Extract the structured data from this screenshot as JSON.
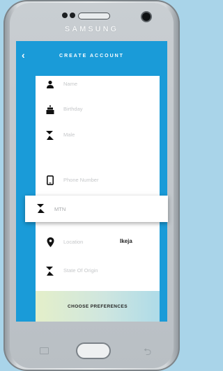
{
  "device": {
    "brand": "SAMSUNG"
  },
  "header": {
    "back_icon": "chevron-left-icon",
    "back_glyph": "‹",
    "title": "CREATE ACCOUNT"
  },
  "form": {
    "fields": [
      {
        "icon": "person-icon",
        "label": "Name",
        "value": ""
      },
      {
        "icon": "birthday-cake-icon",
        "label": "Birthday",
        "value": ""
      },
      {
        "icon": "gender-icon",
        "label": "Male",
        "value": ""
      },
      {
        "icon": "phone-icon",
        "label": "Phone Number",
        "value": ""
      },
      {
        "icon": "location-pin-icon",
        "label": "Location",
        "value": "Ikeja"
      },
      {
        "icon": "hourglass-icon",
        "label": "State Of Origin",
        "value": ""
      }
    ],
    "network_popup": {
      "icon": "hourglass-icon",
      "label": "MTN"
    },
    "cta_label": "CHOOSE PREFERENCES"
  },
  "colors": {
    "screen_bg": "#1a9bd8",
    "page_bg": "#a9d4e9"
  }
}
